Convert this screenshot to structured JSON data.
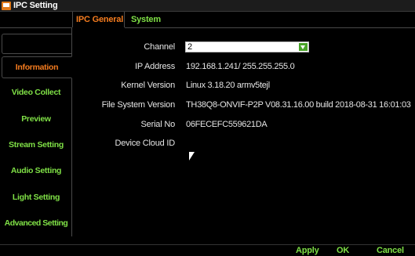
{
  "window": {
    "title": "IPC Setting"
  },
  "tabs": {
    "active": "IPC General",
    "inactive": "System"
  },
  "sidebar": {
    "items": [
      {
        "label": "Information"
      },
      {
        "label": "Video Collect"
      },
      {
        "label": "Preview"
      },
      {
        "label": "Stream Setting"
      },
      {
        "label": "Audio Setting"
      },
      {
        "label": "Light Setting"
      },
      {
        "label": "Advanced Setting"
      }
    ]
  },
  "form": {
    "channel": {
      "label": "Channel",
      "value": "2"
    },
    "ip_address": {
      "label": "IP Address",
      "value": "192.168.1.241/ 255.255.255.0"
    },
    "kernel_version": {
      "label": "Kernel Version",
      "value": "Linux 3.18.20 armv5tejl"
    },
    "fs_version": {
      "label": "File System Version",
      "value": "TH38Q8-ONVIF-P2P V08.31.16.00 build 2018-08-31 16:01:03"
    },
    "serial_no": {
      "label": "Serial No",
      "value": "06FECEFC559621DA"
    },
    "device_cloud_id": {
      "label": "Device Cloud ID",
      "value": ""
    }
  },
  "footer": {
    "apply": "Apply",
    "ok": "OK",
    "cancel": "Cancel"
  },
  "colors": {
    "accent_orange": "#f57c1f",
    "accent_green": "#7fe046",
    "background": "#000000"
  },
  "icons": {
    "app": "camera-settings-icon",
    "dropdown": "chevron-down-icon",
    "pointer": "mouse-cursor-icon"
  }
}
